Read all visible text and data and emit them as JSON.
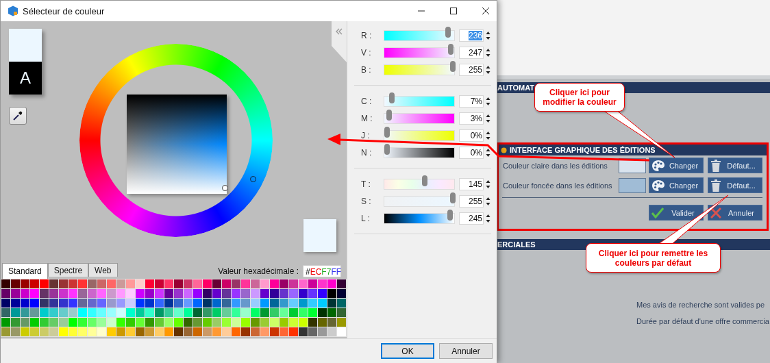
{
  "dialog": {
    "title": "Sélecteur de couleur",
    "preview": {
      "text": "A"
    },
    "slider_groups": [
      {
        "sliders": [
          {
            "label": "R :",
            "kind": "red",
            "level": 0.925,
            "value": "236",
            "selected": true
          },
          {
            "label": "V :",
            "kind": "green",
            "level": 0.969,
            "value": "247",
            "selected": false
          },
          {
            "label": "B :",
            "kind": "blue",
            "level": 1.0,
            "value": "255",
            "selected": false
          }
        ]
      },
      {
        "sliders": [
          {
            "label": "C :",
            "kind": "cyan",
            "level": 0.07,
            "value": "7%",
            "selected": false
          },
          {
            "label": "M :",
            "kind": "magenta",
            "level": 0.03,
            "value": "3%",
            "selected": false
          },
          {
            "label": "J :",
            "kind": "yellow",
            "level": 0.0,
            "value": "0%",
            "selected": false
          },
          {
            "label": "N :",
            "kind": "black",
            "level": 0.0,
            "value": "0%",
            "selected": false
          }
        ]
      },
      {
        "sliders": [
          {
            "label": "T :",
            "kind": "hue",
            "level": 0.57,
            "value": "145",
            "selected": false
          },
          {
            "label": "S :",
            "kind": "saturation",
            "level": 1.0,
            "value": "255",
            "selected": false
          },
          {
            "label": "L :",
            "kind": "lightness",
            "level": 0.96,
            "value": "245",
            "selected": false
          }
        ]
      }
    ],
    "tabs": [
      {
        "label": "Standard",
        "selected": true
      },
      {
        "label": "Spectre",
        "selected": false
      },
      {
        "label": "Web",
        "selected": false
      }
    ],
    "hex_label": "Valeur hexadécimale :",
    "hex_value": "#ECF7FF",
    "palette": [
      {
        "swatches": [
          {
            "color": "#330000"
          },
          {
            "color": "#660000"
          },
          {
            "color": "#990000"
          },
          {
            "color": "#cc0000"
          },
          {
            "color": "#ff0000"
          },
          {
            "color": "#663333"
          },
          {
            "color": "#993333"
          },
          {
            "color": "#cc3333"
          },
          {
            "color": "#ff3333"
          },
          {
            "color": "#996666"
          },
          {
            "color": "#cc6666"
          },
          {
            "color": "#ff6666"
          },
          {
            "color": "#cc9999"
          },
          {
            "color": "#ff9999"
          },
          {
            "color": "#ffcccc"
          },
          {
            "color": "#ff0033"
          },
          {
            "color": "#cc0033"
          },
          {
            "color": "#ff3366"
          },
          {
            "color": "#990033"
          },
          {
            "color": "#cc3366"
          },
          {
            "color": "#ff6699"
          },
          {
            "color": "#ff0066"
          },
          {
            "color": "#660033"
          },
          {
            "color": "#cc0066"
          },
          {
            "color": "#993366"
          },
          {
            "color": "#ff3399"
          },
          {
            "color": "#cc6699"
          },
          {
            "color": "#ff99cc"
          },
          {
            "color": "#ff0099"
          },
          {
            "color": "#990066"
          },
          {
            "color": "#cc3399"
          },
          {
            "color": "#ff66cc"
          },
          {
            "color": "#cc0099"
          },
          {
            "color": "#ff33cc"
          },
          {
            "color": "#ff00cc"
          },
          {
            "color": "#330033"
          }
        ]
      },
      {
        "swatches": [
          {
            "color": "#660066"
          },
          {
            "color": "#990099"
          },
          {
            "color": "#cc00cc"
          },
          {
            "color": "#ff00ff"
          },
          {
            "color": "#663366"
          },
          {
            "color": "#993399"
          },
          {
            "color": "#cc33cc"
          },
          {
            "color": "#ff33ff"
          },
          {
            "color": "#996699"
          },
          {
            "color": "#cc66cc"
          },
          {
            "color": "#ff66ff"
          },
          {
            "color": "#cc99cc"
          },
          {
            "color": "#ff99ff"
          },
          {
            "color": "#ffccff"
          },
          {
            "color": "#cc00ff"
          },
          {
            "color": "#9900cc"
          },
          {
            "color": "#cc33ff"
          },
          {
            "color": "#660099"
          },
          {
            "color": "#9933cc"
          },
          {
            "color": "#cc66ff"
          },
          {
            "color": "#9900ff"
          },
          {
            "color": "#330066"
          },
          {
            "color": "#6600cc"
          },
          {
            "color": "#663399"
          },
          {
            "color": "#9933ff"
          },
          {
            "color": "#9966cc"
          },
          {
            "color": "#cc99ff"
          },
          {
            "color": "#6600cd"
          },
          {
            "color": "#330099"
          },
          {
            "color": "#6633cc"
          },
          {
            "color": "#9966ff"
          },
          {
            "color": "#3300cc"
          },
          {
            "color": "#6633ff"
          },
          {
            "color": "#3300ff"
          },
          {
            "color": "#000000"
          },
          {
            "color": "#000033"
          }
        ]
      },
      {
        "swatches": [
          {
            "color": "#000066"
          },
          {
            "color": "#000099"
          },
          {
            "color": "#0000cc"
          },
          {
            "color": "#0000ff"
          },
          {
            "color": "#333366"
          },
          {
            "color": "#333399"
          },
          {
            "color": "#3333cc"
          },
          {
            "color": "#3333ff"
          },
          {
            "color": "#666699"
          },
          {
            "color": "#6666cc"
          },
          {
            "color": "#6666ff"
          },
          {
            "color": "#9999cc"
          },
          {
            "color": "#9999ff"
          },
          {
            "color": "#ccccff"
          },
          {
            "color": "#0033ff"
          },
          {
            "color": "#0033cc"
          },
          {
            "color": "#3366ff"
          },
          {
            "color": "#003399"
          },
          {
            "color": "#3366cc"
          },
          {
            "color": "#6699ff"
          },
          {
            "color": "#0066ff"
          },
          {
            "color": "#003366"
          },
          {
            "color": "#0066cc"
          },
          {
            "color": "#336699"
          },
          {
            "color": "#3399ff"
          },
          {
            "color": "#6699cc"
          },
          {
            "color": "#99ccff"
          },
          {
            "color": "#0099ff"
          },
          {
            "color": "#006699"
          },
          {
            "color": "#3399cc"
          },
          {
            "color": "#66ccff"
          },
          {
            "color": "#0099cc"
          },
          {
            "color": "#33ccff"
          },
          {
            "color": "#00ccff"
          },
          {
            "color": "#003333"
          },
          {
            "color": "#006666"
          }
        ]
      },
      {
        "swatches": [
          {
            "color": "#336666"
          },
          {
            "color": "#009999"
          },
          {
            "color": "#339999"
          },
          {
            "color": "#669999"
          },
          {
            "color": "#00cccc"
          },
          {
            "color": "#33cccc"
          },
          {
            "color": "#66cccc"
          },
          {
            "color": "#99cccc"
          },
          {
            "color": "#00ffff"
          },
          {
            "color": "#33ffff"
          },
          {
            "color": "#66ffff"
          },
          {
            "color": "#99ffff"
          },
          {
            "color": "#ccffff"
          },
          {
            "color": "#00ffcc"
          },
          {
            "color": "#00cc99"
          },
          {
            "color": "#33ffcc"
          },
          {
            "color": "#009966"
          },
          {
            "color": "#33cc99"
          },
          {
            "color": "#66ffcc"
          },
          {
            "color": "#00ff99"
          },
          {
            "color": "#006633"
          },
          {
            "color": "#339966"
          },
          {
            "color": "#00cc66"
          },
          {
            "color": "#66cc99"
          },
          {
            "color": "#33ff99"
          },
          {
            "color": "#99ffcc"
          },
          {
            "color": "#00ff66"
          },
          {
            "color": "#009933"
          },
          {
            "color": "#33cc66"
          },
          {
            "color": "#66ff99"
          },
          {
            "color": "#00cc33"
          },
          {
            "color": "#33ff66"
          },
          {
            "color": "#00ff33"
          },
          {
            "color": "#003300"
          },
          {
            "color": "#006600"
          },
          {
            "color": "#336633"
          }
        ]
      },
      {
        "swatches": [
          {
            "color": "#009900"
          },
          {
            "color": "#339933"
          },
          {
            "color": "#669966"
          },
          {
            "color": "#00cc00"
          },
          {
            "color": "#33cc33"
          },
          {
            "color": "#66cc66"
          },
          {
            "color": "#99cc99"
          },
          {
            "color": "#00ff00"
          },
          {
            "color": "#33ff33"
          },
          {
            "color": "#66ff66"
          },
          {
            "color": "#99ff99"
          },
          {
            "color": "#ccffcc"
          },
          {
            "color": "#33ff00"
          },
          {
            "color": "#33cc00"
          },
          {
            "color": "#66ff33"
          },
          {
            "color": "#339900"
          },
          {
            "color": "#66cc33"
          },
          {
            "color": "#99ff66"
          },
          {
            "color": "#66ff00"
          },
          {
            "color": "#336600"
          },
          {
            "color": "#669933"
          },
          {
            "color": "#66cc00"
          },
          {
            "color": "#99cc66"
          },
          {
            "color": "#99ff33"
          },
          {
            "color": "#ccff99"
          },
          {
            "color": "#99ff00"
          },
          {
            "color": "#669900"
          },
          {
            "color": "#99cc33"
          },
          {
            "color": "#ccff66"
          },
          {
            "color": "#99cc00"
          },
          {
            "color": "#ccff33"
          },
          {
            "color": "#ccff00"
          },
          {
            "color": "#333300"
          },
          {
            "color": "#666600"
          },
          {
            "color": "#666633"
          },
          {
            "color": "#999900"
          }
        ]
      },
      {
        "swatches": [
          {
            "color": "#999933"
          },
          {
            "color": "#999966"
          },
          {
            "color": "#cccc00"
          },
          {
            "color": "#cccc33"
          },
          {
            "color": "#cccc66"
          },
          {
            "color": "#cccc99"
          },
          {
            "color": "#ffff00"
          },
          {
            "color": "#ffff33"
          },
          {
            "color": "#ffff66"
          },
          {
            "color": "#ffff99"
          },
          {
            "color": "#ffffcc"
          },
          {
            "color": "#ffcc00"
          },
          {
            "color": "#cc9900"
          },
          {
            "color": "#ffcc33"
          },
          {
            "color": "#996600"
          },
          {
            "color": "#cc9933"
          },
          {
            "color": "#ffcc66"
          },
          {
            "color": "#ff9900"
          },
          {
            "color": "#663300"
          },
          {
            "color": "#996633"
          },
          {
            "color": "#cc6600"
          },
          {
            "color": "#cc9966"
          },
          {
            "color": "#ff9933"
          },
          {
            "color": "#ffcc99"
          },
          {
            "color": "#ff6600"
          },
          {
            "color": "#993300"
          },
          {
            "color": "#cc6633"
          },
          {
            "color": "#ff9966"
          },
          {
            "color": "#cc3300"
          },
          {
            "color": "#ff6633"
          },
          {
            "color": "#ff3300"
          },
          {
            "color": "#333333"
          },
          {
            "color": "#666666"
          },
          {
            "color": "#999999"
          },
          {
            "color": "#cccccc"
          },
          {
            "color": "#ffffff"
          }
        ]
      }
    ],
    "buttons": [
      {
        "label": "OK",
        "kind": "default"
      },
      {
        "label": "Annuler",
        "kind": "normal"
      }
    ]
  },
  "background_app": {
    "section_bars": [
      {
        "label": "AUTOMAT"
      }
    ],
    "editions_panel": {
      "title": "INTERFACE GRAPHIQUE DES ÉDITIONS",
      "rows": [
        {
          "label": "Couleur claire dans les éditions",
          "color": "#d9e3ee",
          "change": "Changer",
          "default": "Défaut..."
        },
        {
          "label": "Couleur foncée dans les éditions",
          "color": "#a0bcd6",
          "change": "Changer",
          "default": "Défaut..."
        }
      ],
      "actions": [
        {
          "label": "Valider",
          "kind": "validate"
        },
        {
          "label": "Annuler",
          "kind": "cancel"
        }
      ]
    },
    "lower_bar": "ERCIALES",
    "lines": [
      "Mes avis de recherche sont valides pe",
      "Durée par défaut d'une offre commercia"
    ]
  },
  "callouts": [
    {
      "text": "Cliquer ici pour modifier la couleur"
    },
    {
      "text": "Cliquer ici pour remettre les couleurs par défaut"
    }
  ]
}
